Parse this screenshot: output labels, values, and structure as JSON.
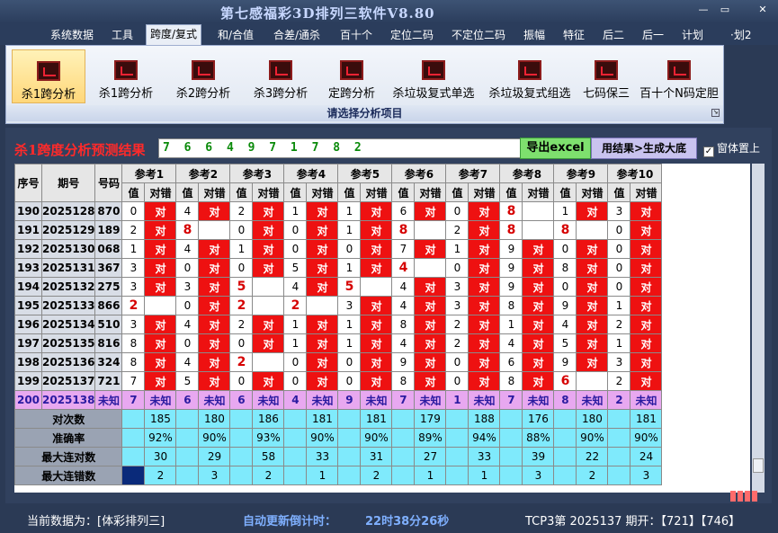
{
  "window": {
    "title": "第七感福彩3D排列三软件V8.80",
    "min": "—",
    "restore": "▭",
    "close": "✕"
  },
  "menu": [
    "系统数据",
    "工具",
    "跨度/复式",
    "和/合值",
    "合差/通杀",
    "百十个",
    "定位二码",
    "不定位二码",
    "振幅",
    "特征",
    "后二",
    "后一",
    "计划",
    "·划2"
  ],
  "menu_active": 2,
  "ribbon": {
    "buttons": [
      "杀1跨分析",
      "杀1跨分析",
      "杀2跨分析",
      "杀3跨分析",
      "定跨分析",
      "杀垃圾复式单选",
      "杀垃圾复式组选",
      "七码保三",
      "百十个N码定胆"
    ],
    "selected": 0,
    "group_label": "请选择分析项目"
  },
  "result": {
    "title": "杀1跨度分析预测结果",
    "value": "7 6 6 4 9 7 1 7 8 2",
    "export": "导出excel",
    "generate": "用结果>生成大底",
    "pin_label": "窗体置上",
    "pin_checked": "✓"
  },
  "table": {
    "h_seq": "序号",
    "h_period": "期号",
    "h_number": "号码",
    "refs": [
      "参考1",
      "参考2",
      "参考3",
      "参考4",
      "参考5",
      "参考6",
      "参考7",
      "参考8",
      "参考9",
      "参考10"
    ],
    "sub_val": "值",
    "sub_dc": "对错",
    "rows": [
      {
        "seq": "190",
        "period": "2025128",
        "num": "870",
        "vals": [
          "0",
          "4",
          "2",
          "1",
          "1",
          "6",
          "0",
          "8",
          "1",
          "3"
        ],
        "ok": [
          1,
          1,
          1,
          1,
          1,
          1,
          1,
          0,
          1,
          1
        ]
      },
      {
        "seq": "191",
        "period": "2025129",
        "num": "189",
        "vals": [
          "2",
          "8",
          "0",
          "0",
          "1",
          "8",
          "2",
          "8",
          "8",
          "0"
        ],
        "ok": [
          1,
          0,
          1,
          1,
          1,
          0,
          1,
          0,
          0,
          1
        ]
      },
      {
        "seq": "192",
        "period": "2025130",
        "num": "068",
        "vals": [
          "1",
          "4",
          "1",
          "0",
          "0",
          "7",
          "1",
          "9",
          "0",
          "0"
        ],
        "ok": [
          1,
          1,
          1,
          1,
          1,
          1,
          1,
          1,
          1,
          1
        ]
      },
      {
        "seq": "193",
        "period": "2025131",
        "num": "367",
        "vals": [
          "3",
          "0",
          "0",
          "5",
          "1",
          "4",
          "0",
          "9",
          "8",
          "0"
        ],
        "ok": [
          1,
          1,
          1,
          1,
          1,
          0,
          1,
          1,
          1,
          1
        ]
      },
      {
        "seq": "194",
        "period": "2025132",
        "num": "275",
        "vals": [
          "3",
          "3",
          "5",
          "4",
          "5",
          "4",
          "3",
          "9",
          "0",
          "0"
        ],
        "ok": [
          1,
          1,
          0,
          1,
          0,
          1,
          1,
          1,
          1,
          1
        ]
      },
      {
        "seq": "195",
        "period": "2025133",
        "num": "866",
        "vals": [
          "2",
          "0",
          "2",
          "2",
          "3",
          "4",
          "3",
          "8",
          "9",
          "1"
        ],
        "ok": [
          0,
          1,
          0,
          0,
          1,
          1,
          1,
          1,
          1,
          1
        ]
      },
      {
        "seq": "196",
        "period": "2025134",
        "num": "510",
        "vals": [
          "3",
          "4",
          "2",
          "1",
          "1",
          "8",
          "2",
          "1",
          "4",
          "2"
        ],
        "ok": [
          1,
          1,
          1,
          1,
          1,
          1,
          1,
          1,
          1,
          1
        ]
      },
      {
        "seq": "197",
        "period": "2025135",
        "num": "816",
        "vals": [
          "8",
          "0",
          "0",
          "1",
          "1",
          "4",
          "2",
          "4",
          "5",
          "1"
        ],
        "ok": [
          1,
          1,
          1,
          1,
          1,
          1,
          1,
          1,
          1,
          1
        ]
      },
      {
        "seq": "198",
        "period": "2025136",
        "num": "324",
        "vals": [
          "8",
          "4",
          "2",
          "0",
          "0",
          "9",
          "0",
          "6",
          "9",
          "3"
        ],
        "ok": [
          1,
          1,
          0,
          1,
          1,
          1,
          1,
          1,
          1,
          1
        ]
      },
      {
        "seq": "199",
        "period": "2025137",
        "num": "721",
        "vals": [
          "7",
          "5",
          "0",
          "0",
          "0",
          "8",
          "0",
          "8",
          "6",
          "2"
        ],
        "ok": [
          1,
          1,
          1,
          1,
          1,
          1,
          1,
          1,
          0,
          1
        ]
      }
    ],
    "unknown_row": {
      "seq": "200",
      "period": "2025138",
      "num": "未知",
      "vals": [
        "7",
        "6",
        "6",
        "4",
        "9",
        "7",
        "1",
        "7",
        "8",
        "2"
      ],
      "dc": "未知"
    },
    "dui": "对",
    "stats": [
      {
        "label": "对次数",
        "vals": [
          "185",
          "180",
          "186",
          "181",
          "181",
          "179",
          "188",
          "176",
          "180",
          "181"
        ]
      },
      {
        "label": "准确率",
        "vals": [
          "92%",
          "90%",
          "93%",
          "90%",
          "90%",
          "89%",
          "94%",
          "88%",
          "90%",
          "90%"
        ]
      },
      {
        "label": "最大连对数",
        "vals": [
          "30",
          "29",
          "58",
          "33",
          "31",
          "27",
          "33",
          "39",
          "22",
          "24"
        ]
      },
      {
        "label": "最大连错数",
        "vals": [
          "2",
          "3",
          "2",
          "1",
          "2",
          "1",
          "1",
          "3",
          "2",
          "3"
        ]
      }
    ]
  },
  "status": {
    "current": "当前数据为：[体彩排列三]",
    "countdown_label": "自动更新倒计时：",
    "countdown": "22时38分26秒",
    "period": "TCP3第 2025137 期开：【721】【746】"
  }
}
